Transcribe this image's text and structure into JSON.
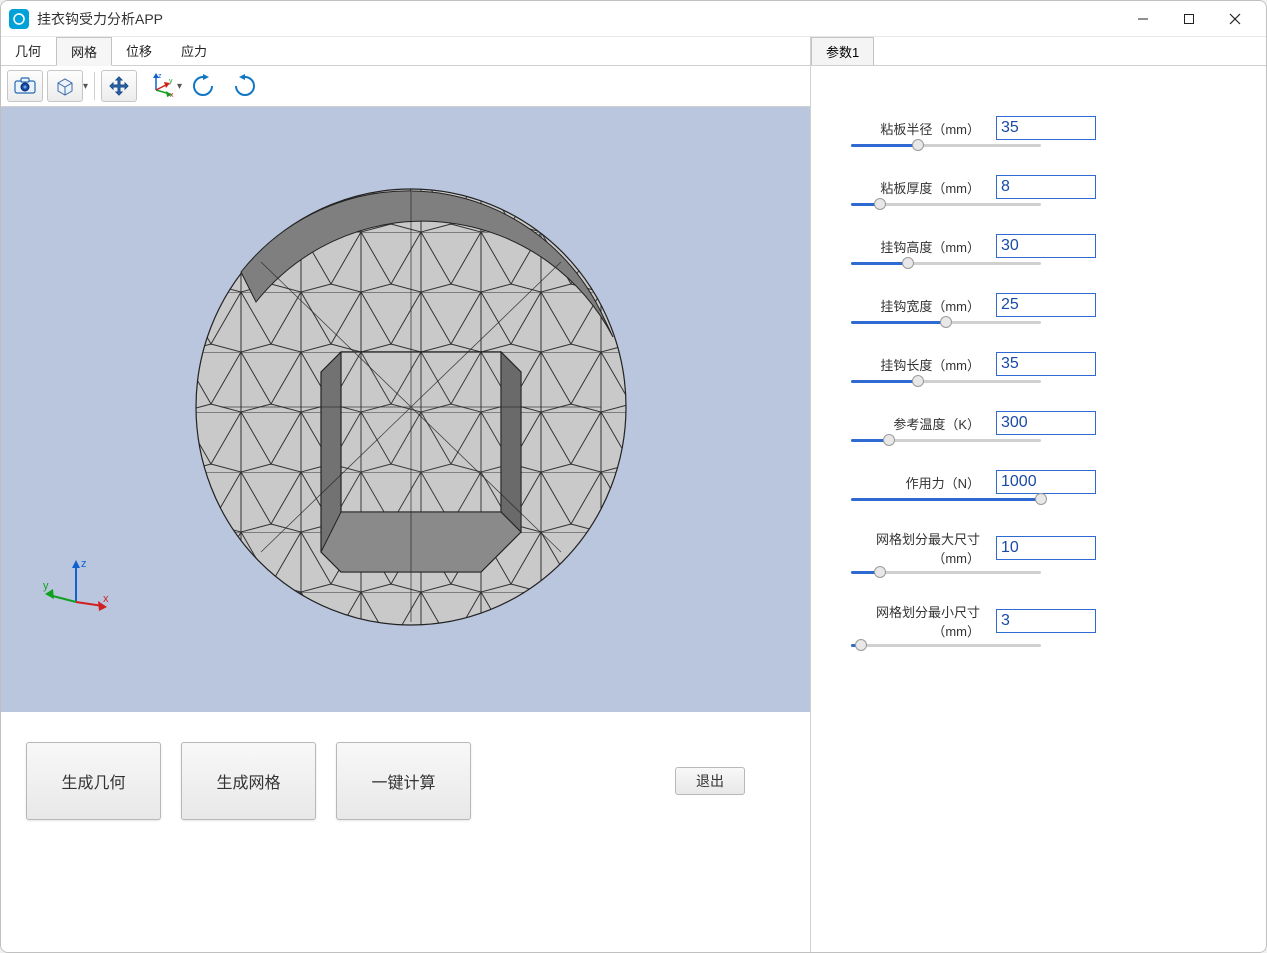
{
  "window": {
    "title": "挂衣钩受力分析APP"
  },
  "tabs": {
    "items": [
      {
        "label": "几何"
      },
      {
        "label": "网格"
      },
      {
        "label": "位移"
      },
      {
        "label": "应力"
      }
    ],
    "active_index": 1
  },
  "right_panel": {
    "tab_label": "参数1"
  },
  "buttons": {
    "gen_geometry": "生成几何",
    "gen_mesh": "生成网格",
    "compute": "一键计算",
    "exit": "退出"
  },
  "toolbar_icons": {
    "camera": "camera-icon",
    "box": "scene-box-icon",
    "move": "move-tool-icon",
    "axes": "xyz-axes-icon",
    "rotate_ccw": "rotate-ccw-icon",
    "rotate_cw": "rotate-cw-icon"
  },
  "axis": {
    "x": "x",
    "y": "y",
    "z": "z"
  },
  "params": [
    {
      "label": "粘板半径（mm）",
      "value": "35",
      "fill": 35
    },
    {
      "label": "粘板厚度（mm）",
      "value": "8",
      "fill": 15
    },
    {
      "label": "挂钩高度（mm）",
      "value": "30",
      "fill": 30
    },
    {
      "label": "挂钩宽度（mm）",
      "value": "25",
      "fill": 50
    },
    {
      "label": "挂钩长度（mm）",
      "value": "35",
      "fill": 35
    },
    {
      "label": "参考温度（K）",
      "value": "300",
      "fill": 20
    },
    {
      "label": "作用力（N）",
      "value": "1000",
      "fill": 100
    },
    {
      "label": "网格划分最大尺寸（mm）",
      "value": "10",
      "fill": 15
    },
    {
      "label": "网格划分最小尺寸（mm）",
      "value": "3",
      "fill": 5
    }
  ]
}
